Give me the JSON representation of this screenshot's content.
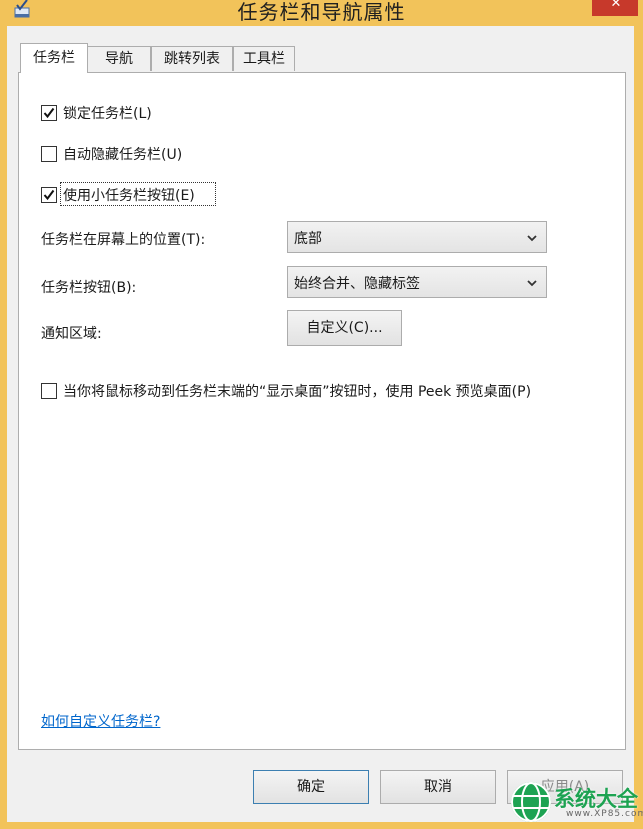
{
  "window": {
    "title": "任务栏和导航属性",
    "close_glyph": "✕"
  },
  "tabs": [
    {
      "label": "任务栏",
      "active": true
    },
    {
      "label": "导航",
      "active": false
    },
    {
      "label": "跳转列表",
      "active": false
    },
    {
      "label": "工具栏",
      "active": false
    }
  ],
  "options": {
    "lock_taskbar": {
      "label": "锁定任务栏(L)",
      "checked": true
    },
    "auto_hide": {
      "label": "自动隐藏任务栏(U)",
      "checked": false
    },
    "small_buttons": {
      "label": "使用小任务栏按钮(E)",
      "checked": true
    }
  },
  "position": {
    "label": "任务栏在屏幕上的位置(T):",
    "value": "底部"
  },
  "buttons_mode": {
    "label": "任务栏按钮(B):",
    "value": "始终合并、隐藏标签"
  },
  "notification": {
    "label": "通知区域:",
    "button_label": "自定义(C)..."
  },
  "peek": {
    "label": "当你将鼠标移动到任务栏末端的“显示桌面”按钮时，使用 Peek 预览桌面(P)",
    "checked": false
  },
  "help_link": "如何自定义任务栏?",
  "footer": {
    "ok": "确定",
    "cancel": "取消",
    "apply": "应用(A)"
  },
  "watermark": {
    "text": "系统大全",
    "url": "www.XP85.com"
  },
  "colors": {
    "frame": "#f2c35a",
    "close": "#c7392b",
    "link": "#0066cc",
    "watermark": "#1da352"
  }
}
